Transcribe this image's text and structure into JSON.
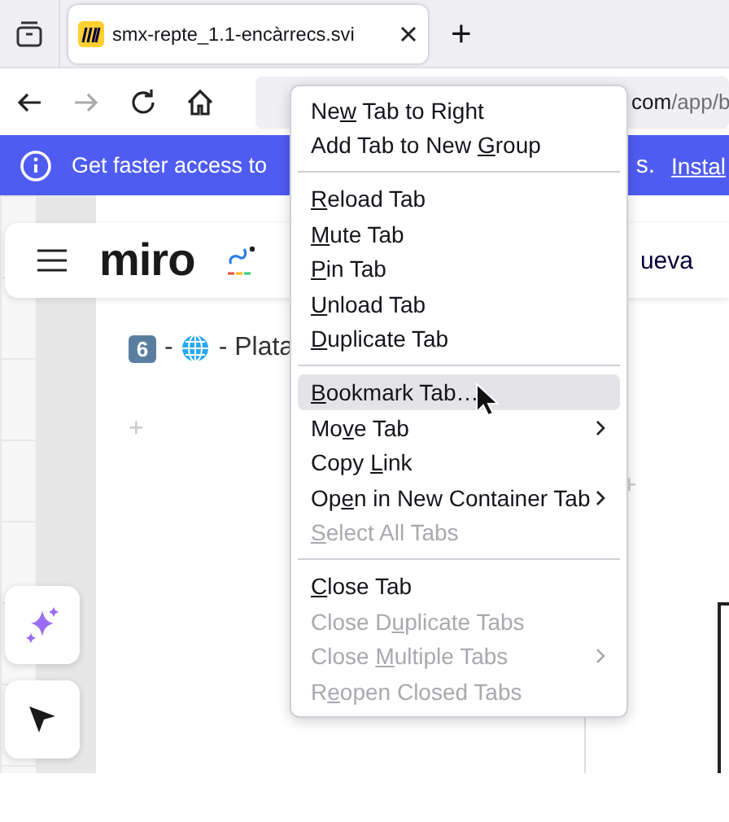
{
  "tab_strip": {
    "tabs": [
      {
        "title": "smx-repte_1.1-encàrrecs.svi",
        "selected": true
      }
    ],
    "new_tab": "+"
  },
  "nav_buttons": [
    {
      "kind": "back",
      "disabled": false
    },
    {
      "kind": "forward",
      "disabled": true
    },
    {
      "kind": "reload",
      "disabled": false
    },
    {
      "kind": "home",
      "disabled": false
    }
  ],
  "address_bar": {
    "host_tail": "com",
    "path": "/app/b"
  },
  "banner": {
    "message": "Get faster access to",
    "message_tail": "s.",
    "link": "Instal"
  },
  "board": {
    "logo": "miro",
    "board_name": "ueva",
    "frame": {
      "badge": "6",
      "separator": "-",
      "title": "- Plata"
    },
    "add_marks": [
      "+",
      "+"
    ]
  },
  "context_menu": {
    "sections": [
      [
        {
          "prefix": "Ne",
          "key": "w",
          "suffix": " Tab to Right",
          "disabled": false,
          "selected": false,
          "submenu": false
        },
        {
          "prefix": "Add Tab to New ",
          "key": "G",
          "suffix": "roup",
          "disabled": false,
          "selected": false,
          "submenu": false
        }
      ],
      [
        {
          "key": "R",
          "suffix": "eload Tab",
          "disabled": false,
          "selected": false,
          "submenu": false
        },
        {
          "key": "M",
          "suffix": "ute Tab",
          "disabled": false,
          "selected": false,
          "submenu": false
        },
        {
          "key": "P",
          "suffix": "in Tab",
          "disabled": false,
          "selected": false,
          "submenu": false
        },
        {
          "key": "U",
          "suffix": "nload Tab",
          "disabled": false,
          "selected": false,
          "submenu": false
        },
        {
          "key": "D",
          "suffix": "uplicate Tab",
          "disabled": false,
          "selected": false,
          "submenu": false
        }
      ],
      [
        {
          "key": "B",
          "suffix": "ookmark Tab…",
          "disabled": false,
          "selected": true,
          "submenu": false
        },
        {
          "prefix": "Mo",
          "key": "v",
          "suffix": "e Tab",
          "disabled": false,
          "selected": false,
          "submenu": true
        },
        {
          "prefix": "Copy ",
          "key": "L",
          "suffix": "ink",
          "disabled": false,
          "selected": false,
          "submenu": false
        },
        {
          "prefix": "Op",
          "key": "e",
          "suffix": "n in New Container Tab",
          "disabled": false,
          "selected": false,
          "submenu": true
        },
        {
          "key": "S",
          "suffix": "elect All Tabs",
          "disabled": true,
          "selected": false,
          "submenu": false
        }
      ],
      [
        {
          "key": "C",
          "suffix": "lose Tab",
          "disabled": false,
          "selected": false,
          "submenu": false
        },
        {
          "prefix": "Close D",
          "key": "u",
          "suffix": "plicate Tabs",
          "disabled": true,
          "selected": false,
          "submenu": false
        },
        {
          "prefix": "Close ",
          "key": "M",
          "suffix": "ultiple Tabs",
          "disabled": true,
          "selected": false,
          "submenu": true
        },
        {
          "prefix": "R",
          "key": "e",
          "suffix": "open Closed Tabs",
          "disabled": true,
          "selected": false,
          "submenu": false
        }
      ]
    ]
  }
}
